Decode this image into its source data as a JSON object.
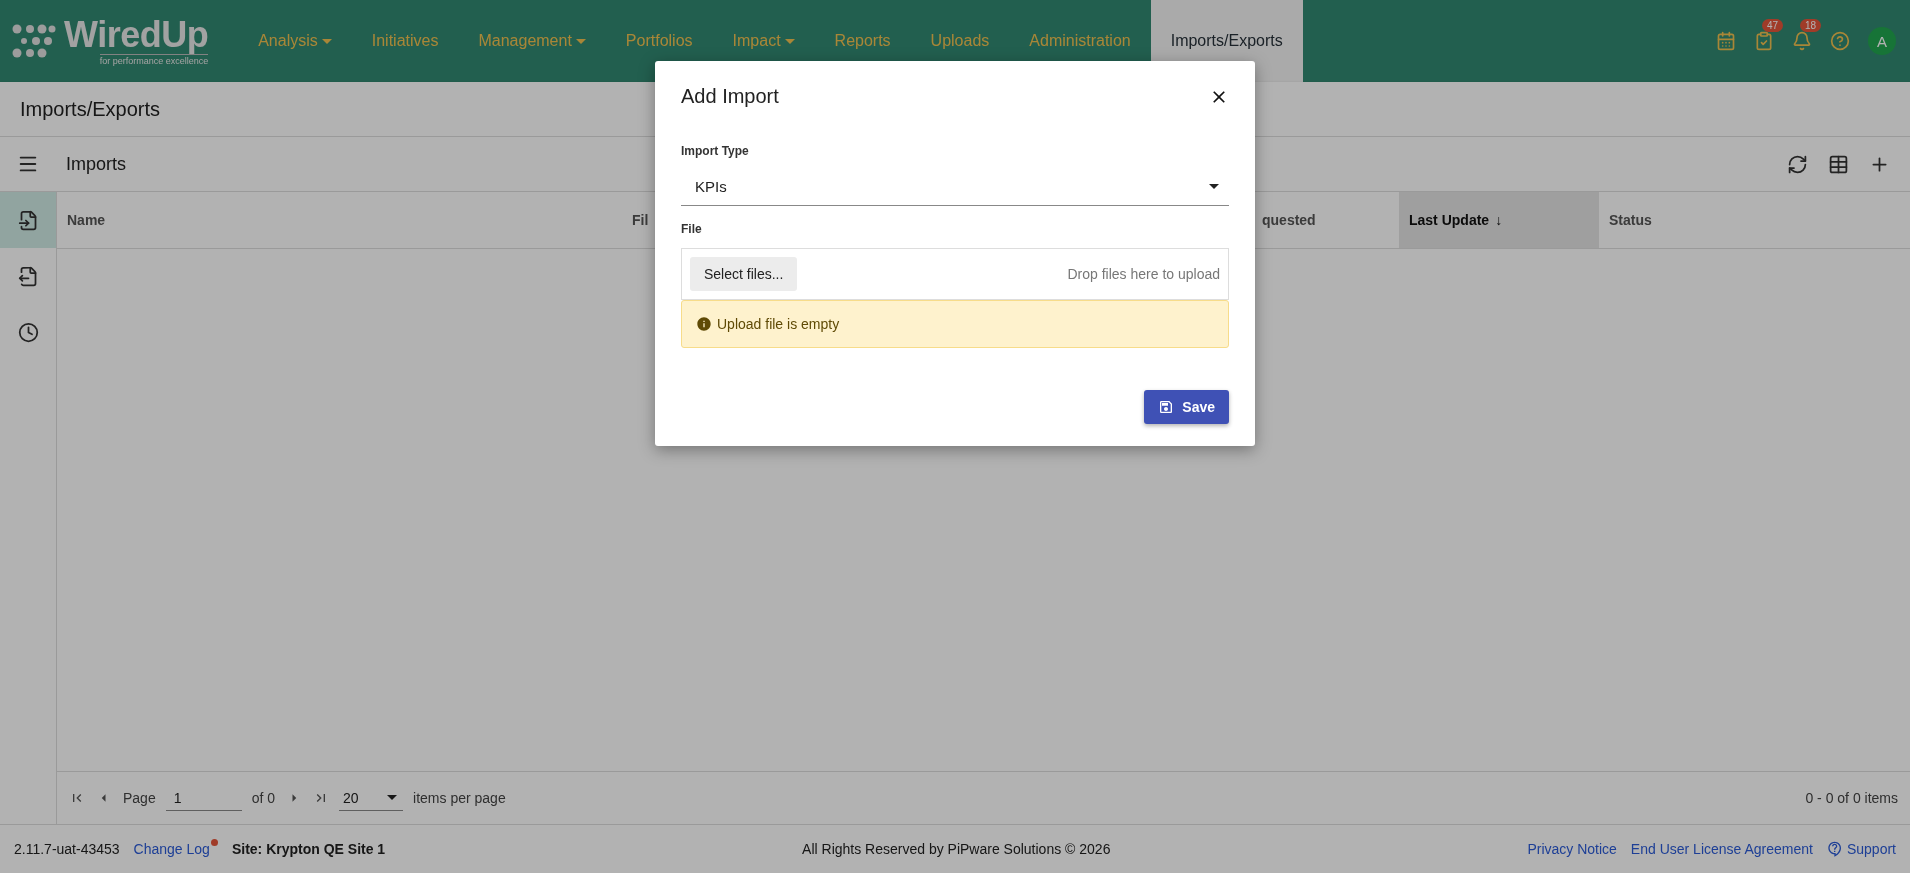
{
  "header": {
    "logo": {
      "name": "WiredUp",
      "tagline": "for performance excellence"
    },
    "nav": [
      {
        "label": "Analysis",
        "dropdown": true,
        "selected": false
      },
      {
        "label": "Initiatives",
        "dropdown": false,
        "selected": false
      },
      {
        "label": "Management",
        "dropdown": true,
        "selected": false
      },
      {
        "label": "Portfolios",
        "dropdown": false,
        "selected": false
      },
      {
        "label": "Impact",
        "dropdown": true,
        "selected": false
      },
      {
        "label": "Reports",
        "dropdown": false,
        "selected": false
      },
      {
        "label": "Uploads",
        "dropdown": false,
        "selected": false
      },
      {
        "label": "Administration",
        "dropdown": false,
        "selected": false
      },
      {
        "label": "Imports/Exports",
        "dropdown": false,
        "selected": true
      }
    ],
    "tools": [
      {
        "kind": "calendar"
      },
      {
        "kind": "tasks",
        "badge": "47"
      },
      {
        "kind": "bell",
        "badge": "18"
      },
      {
        "kind": "help"
      }
    ],
    "avatar": "A"
  },
  "page_title": "Imports/Exports",
  "sidebar": {
    "items": [
      {
        "kind": "import",
        "selected": true
      },
      {
        "kind": "export",
        "selected": false
      },
      {
        "kind": "history",
        "selected": false
      }
    ]
  },
  "toolbar": {
    "title": "Imports",
    "actions": [
      {
        "kind": "refresh"
      },
      {
        "kind": "columns"
      },
      {
        "kind": "add"
      }
    ]
  },
  "table": {
    "columns": [
      {
        "label": "Name",
        "sorted": false
      },
      {
        "label": "Fil",
        "sorted": false
      },
      {
        "label": "quested",
        "sorted": false
      },
      {
        "label": "Last Update",
        "sorted": true,
        "sort_indicator": "↓"
      },
      {
        "label": "Status",
        "sorted": false
      }
    ]
  },
  "pager": {
    "page_label": "Page",
    "page": "1",
    "of": "of 0",
    "page_size": "20",
    "page_size_label": "items per page",
    "summary": "0 - 0 of 0 items"
  },
  "footer": {
    "version": "2.11.7-uat-43453",
    "change_log": {
      "label": "Change Log",
      "has_update": true
    },
    "site": "Site: Krypton QE Site 1",
    "copyright": "All Rights Reserved by PiPware Solutions © 2026",
    "links": [
      {
        "label": "Privacy Notice",
        "icon": false
      },
      {
        "label": "End User License Agreement",
        "icon": false
      },
      {
        "label": "Support",
        "icon": true
      }
    ]
  },
  "dialog": {
    "title": "Add Import",
    "import_type": {
      "label": "Import Type",
      "value": "KPIs"
    },
    "file": {
      "label": "File",
      "button": "Select files...",
      "hint": "Drop files here to upload",
      "warning": "Upload file is empty"
    },
    "save": "Save"
  }
}
